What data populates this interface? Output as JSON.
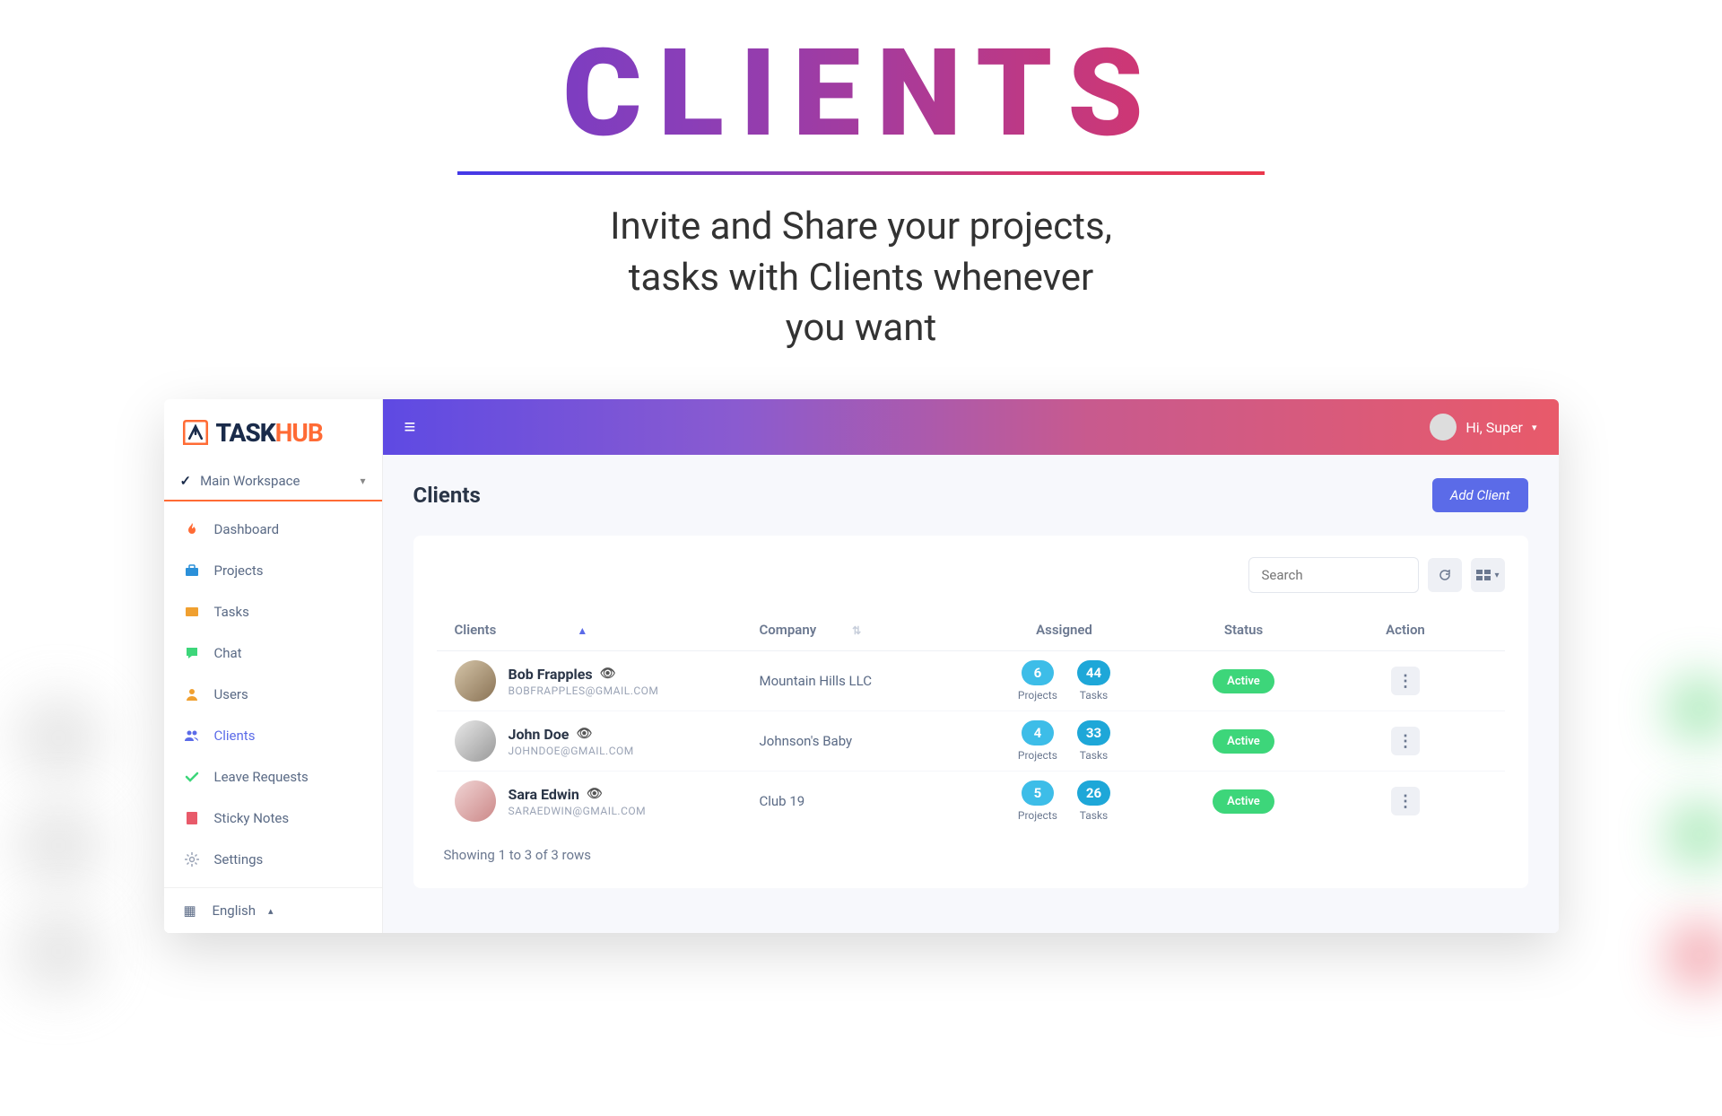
{
  "hero": {
    "title": "CLIENTS",
    "subtitle_l1": "Invite and Share your projects,",
    "subtitle_l2": "tasks  with Clients whenever",
    "subtitle_l3": "you want"
  },
  "app": {
    "logo_task": "TASK",
    "logo_hub": "HUB",
    "workspace": "Main Workspace",
    "nav": [
      {
        "label": "Dashboard",
        "icon": "flame",
        "color": "#ff6b35"
      },
      {
        "label": "Projects",
        "icon": "briefcase",
        "color": "#2b90d9"
      },
      {
        "label": "Tasks",
        "icon": "card",
        "color": "#f0a030"
      },
      {
        "label": "Chat",
        "icon": "chat",
        "color": "#3dd67a"
      },
      {
        "label": "Users",
        "icon": "user",
        "color": "#f0a030"
      },
      {
        "label": "Clients",
        "icon": "users",
        "color": "#5b6be8",
        "active": true
      },
      {
        "label": "Leave Requests",
        "icon": "check",
        "color": "#3dd67a"
      },
      {
        "label": "Sticky Notes",
        "icon": "note",
        "color": "#e85a6a"
      },
      {
        "label": "Settings",
        "icon": "gear",
        "color": "#9aa3b5"
      }
    ],
    "language": "English",
    "user_greeting": "Hi, Super",
    "page_title": "Clients",
    "add_button": "Add Client",
    "search_placeholder": "Search",
    "table": {
      "headers": {
        "clients": "Clients",
        "company": "Company",
        "assigned": "Assigned",
        "status": "Status",
        "action": "Action"
      },
      "stat_labels": {
        "projects": "Projects",
        "tasks": "Tasks"
      },
      "rows": [
        {
          "name": "Bob Frapples",
          "email": "BOBFRAPPLES@GMAIL.COM",
          "company": "Mountain Hills LLC",
          "projects": "6",
          "tasks": "44",
          "status": "Active"
        },
        {
          "name": "John Doe",
          "email": "JOHNDOE@GMAIL.COM",
          "company": "Johnson's Baby",
          "projects": "4",
          "tasks": "33",
          "status": "Active"
        },
        {
          "name": "Sara Edwin",
          "email": "SARAEDWIN@GMAIL.COM",
          "company": "Club 19",
          "projects": "5",
          "tasks": "26",
          "status": "Active"
        }
      ],
      "footer": "Showing 1 to 3 of 3 rows"
    }
  }
}
